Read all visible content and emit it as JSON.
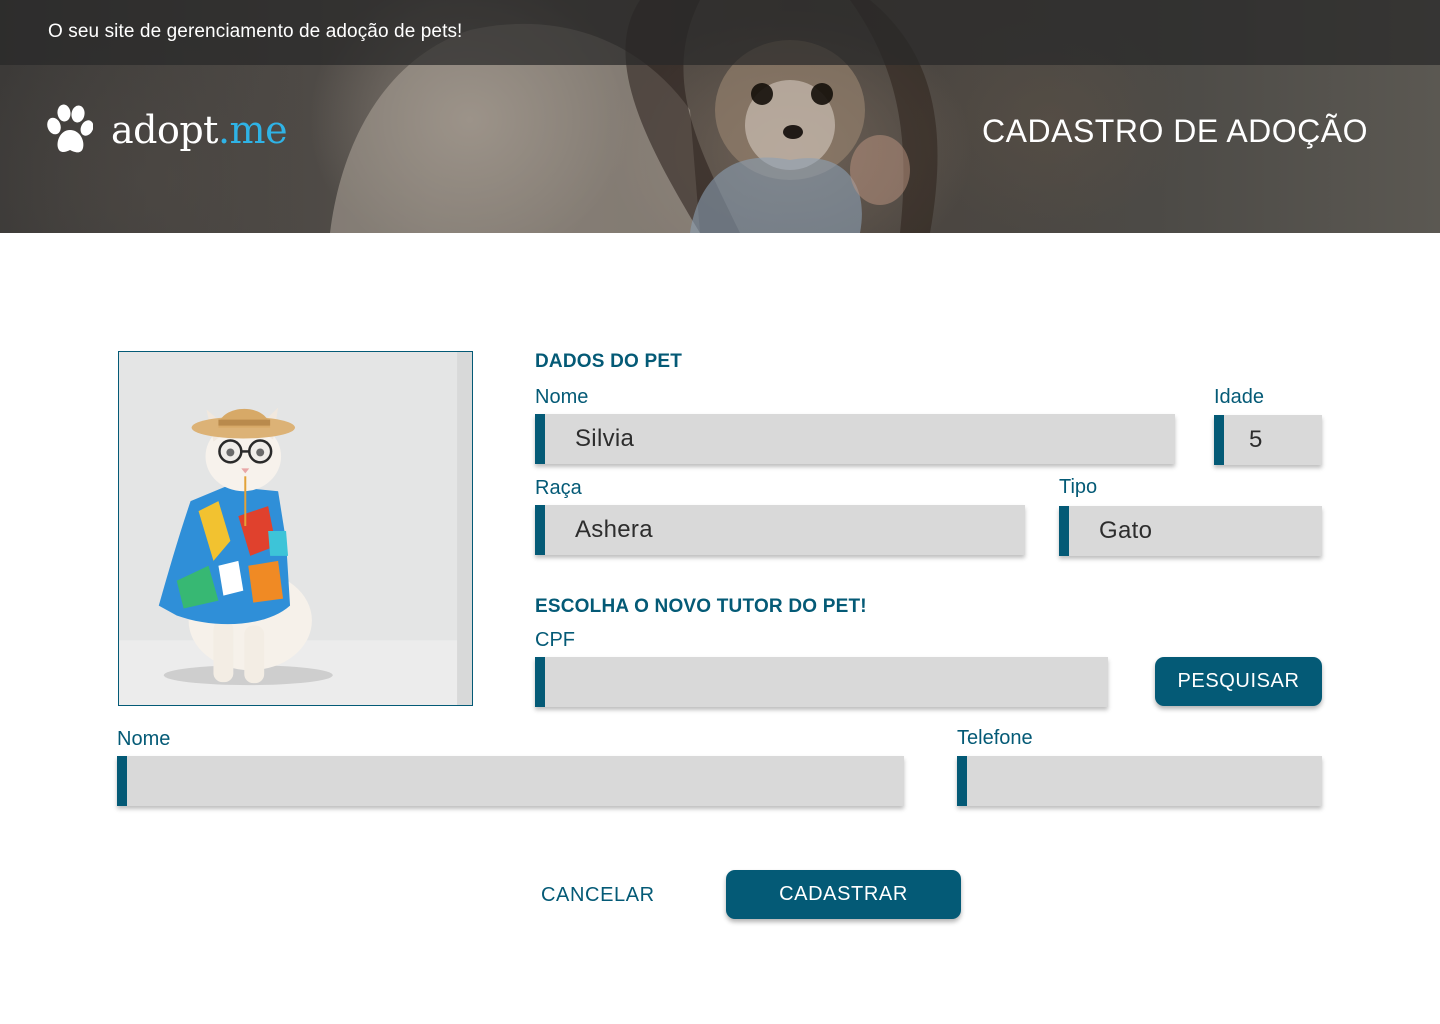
{
  "header": {
    "tagline": "O seu site de gerenciamento de adoção de pets!",
    "logo": {
      "name": "adopt",
      "suffix": ".me",
      "icon": "paw-icon"
    },
    "page_title": "CADASTRO DE ADOÇÃO"
  },
  "pet_section": {
    "title": "DADOS DO PET",
    "nome_label": "Nome",
    "nome_value": "Silvia",
    "idade_label": "Idade",
    "idade_value": "5",
    "raca_label": "Raça",
    "raca_value": "Ashera",
    "tipo_label": "Tipo",
    "tipo_value": "Gato"
  },
  "tutor_section": {
    "title": "ESCOLHA O NOVO TUTOR DO PET!",
    "cpf_label": "CPF",
    "cpf_value": "",
    "search_button": "PESQUISAR",
    "nome_label": "Nome",
    "nome_value": "",
    "telefone_label": "Telefone",
    "telefone_value": ""
  },
  "actions": {
    "cancel": "CANCELAR",
    "submit": "CADASTRAR"
  },
  "colors": {
    "primary": "#045a76",
    "logo_accent": "#2fb3e6",
    "field_bg": "#d9d9d9"
  }
}
